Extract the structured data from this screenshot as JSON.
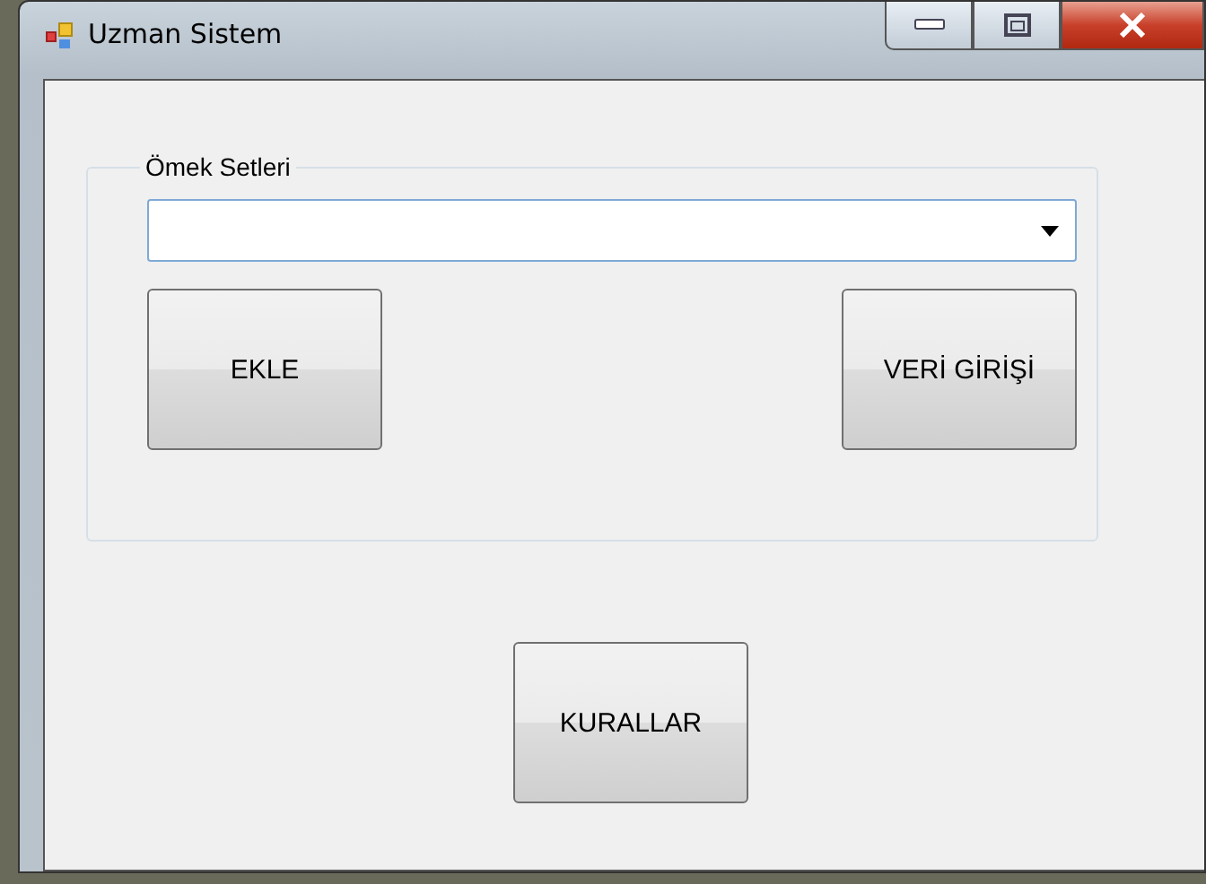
{
  "window": {
    "title": "Uzman Sistem"
  },
  "group": {
    "label": "Ömek Setleri",
    "buttons": [
      "EKLE",
      "VERİ GİRİŞİ"
    ]
  },
  "buttons": [
    "KURALLAR"
  ]
}
